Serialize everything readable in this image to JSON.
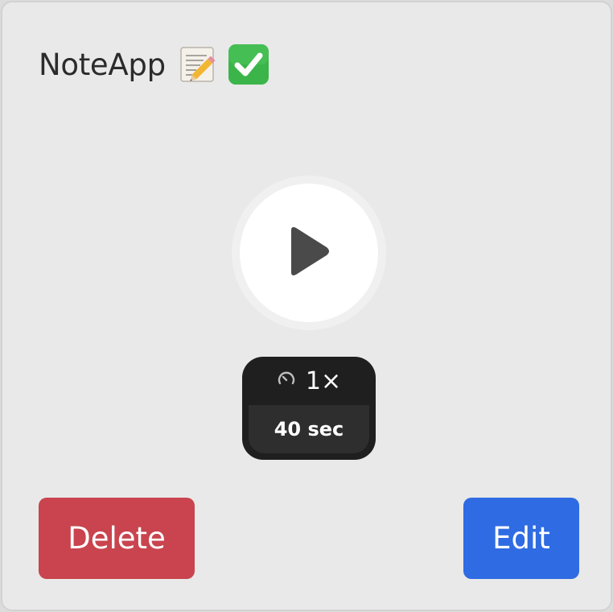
{
  "app": {
    "title": "NoteApp",
    "title_icons": [
      "notepad-pencil-icon",
      "check-mark-button-icon"
    ]
  },
  "player": {
    "play_icon": "play-icon",
    "speed_icon": "gauge-icon",
    "speed": "1×",
    "duration": "40 sec"
  },
  "actions": {
    "delete_label": "Delete",
    "edit_label": "Edit"
  },
  "colors": {
    "delete": "#c9444e",
    "edit": "#2f6be2",
    "card_background": "#e9e9e9",
    "check_green": "#3bb54a"
  }
}
